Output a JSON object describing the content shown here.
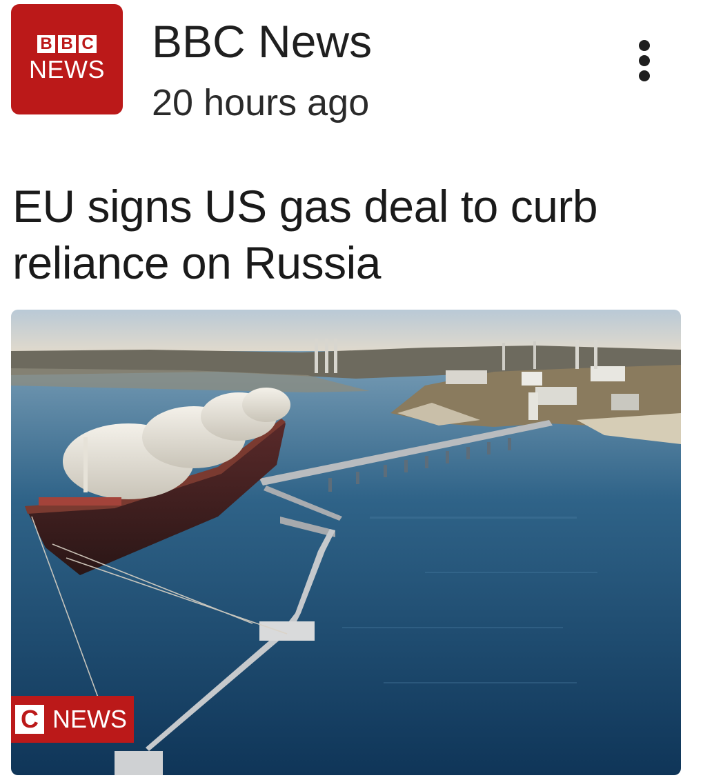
{
  "header": {
    "logo": {
      "letters": [
        "B",
        "B",
        "C"
      ],
      "word": "NEWS",
      "brand_color": "#bb1919"
    },
    "source_name": "BBC News",
    "timestamp": "20 hours ago",
    "more_icon": "more-vert-icon"
  },
  "article": {
    "headline": "EU signs US gas deal to curb reliance on Russia",
    "image": {
      "watermark": {
        "letter": "C",
        "word": "NEWS"
      }
    }
  }
}
